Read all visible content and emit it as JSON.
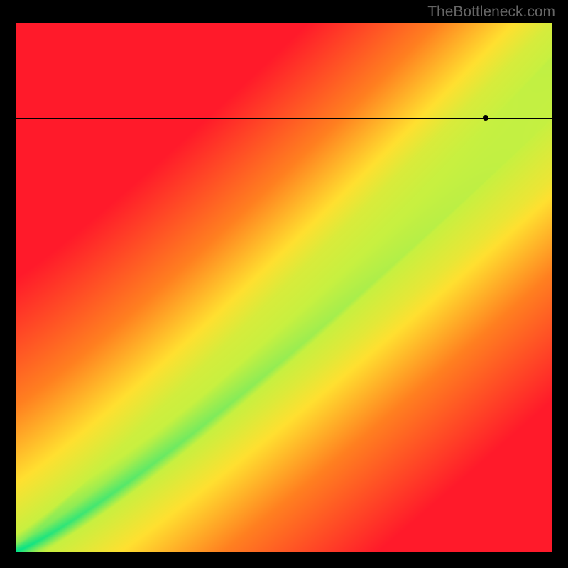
{
  "watermark": "TheBottleneck.com",
  "chart_data": {
    "type": "heatmap",
    "title": "",
    "xlabel": "",
    "ylabel": "",
    "xlim": [
      0,
      100
    ],
    "ylim": [
      0,
      100
    ],
    "crosshair": {
      "x": 87.5,
      "y": 82
    },
    "optimal_curve_description": "Green optimal band runs diagonally from bottom-left to top-right, slightly convex, widening toward the upper right. Colors transition from green (optimal) through yellow-green, yellow, orange, to red (worst) as distance from the band increases.",
    "color_stops": {
      "optimal": "#00E28A",
      "near": "#C8F040",
      "mid": "#FFE030",
      "far": "#FF8020",
      "worst": "#FF1A2A"
    },
    "sample_field_values": [
      {
        "x": 0,
        "y": 0,
        "zone": "optimal"
      },
      {
        "x": 50,
        "y": 42,
        "zone": "optimal"
      },
      {
        "x": 100,
        "y": 80,
        "zone": "optimal"
      },
      {
        "x": 0,
        "y": 100,
        "zone": "worst"
      },
      {
        "x": 100,
        "y": 0,
        "zone": "worst"
      },
      {
        "x": 87.5,
        "y": 82,
        "zone": "near"
      }
    ]
  }
}
